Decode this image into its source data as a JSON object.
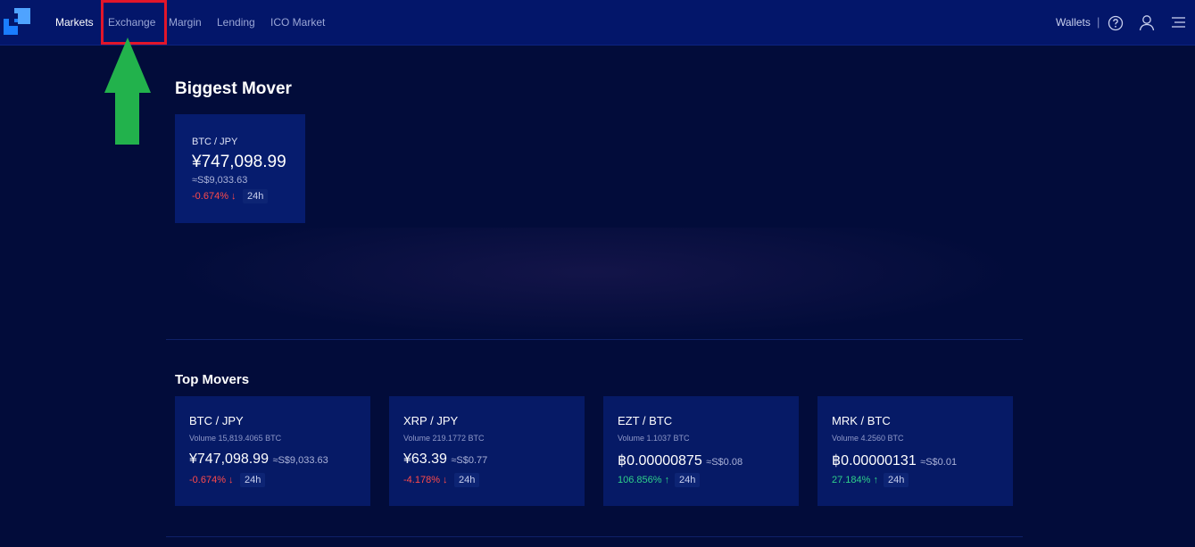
{
  "nav": {
    "items": [
      {
        "label": "Markets",
        "active": true
      },
      {
        "label": "Exchange",
        "active": false
      },
      {
        "label": "Margin",
        "active": false
      },
      {
        "label": "Lending",
        "active": false
      },
      {
        "label": "ICO Market",
        "active": false
      }
    ],
    "wallets_label": "Wallets",
    "separator": "|"
  },
  "biggest_mover": {
    "title": "Biggest Mover",
    "pair": "BTC / JPY",
    "price": "¥747,098.99",
    "fiat": "≈S$9,033.63",
    "change": "-0.674%",
    "period": "24h"
  },
  "top_movers": {
    "title": "Top Movers",
    "cards": [
      {
        "pair": "BTC / JPY",
        "volume": "Volume 15,819.4065 BTC",
        "price": "¥747,098.99",
        "fiat": "≈S$9,033.63",
        "change": "-0.674%",
        "direction": "down",
        "period": "24h"
      },
      {
        "pair": "XRP / JPY",
        "volume": "Volume 219.1772 BTC",
        "price": "¥63.39",
        "fiat": "≈S$0.77",
        "change": "-4.178%",
        "direction": "down",
        "period": "24h"
      },
      {
        "pair": "EZT / BTC",
        "volume": "Volume 1.1037 BTC",
        "price": "฿0.00000875",
        "fiat": "≈S$0.08",
        "change": "106.856%",
        "direction": "up",
        "period": "24h"
      },
      {
        "pair": "MRK / BTC",
        "volume": "Volume 4.2560 BTC",
        "price": "฿0.00000131",
        "fiat": "≈S$0.01",
        "change": "27.184%",
        "direction": "up",
        "period": "24h"
      }
    ]
  },
  "colors": {
    "background": "#020c3a",
    "topbar": "#03166a",
    "card": "#061a66",
    "negative": "#ff4a4a",
    "positive": "#2fd08a",
    "highlight": "#e2162a",
    "arrow": "#22b24c"
  },
  "icons": {
    "logo": "liquid-logo",
    "help": "help-icon",
    "user": "user-icon",
    "menu": "hamburger-icon",
    "down": "arrow-down-icon",
    "up": "arrow-up-icon"
  }
}
